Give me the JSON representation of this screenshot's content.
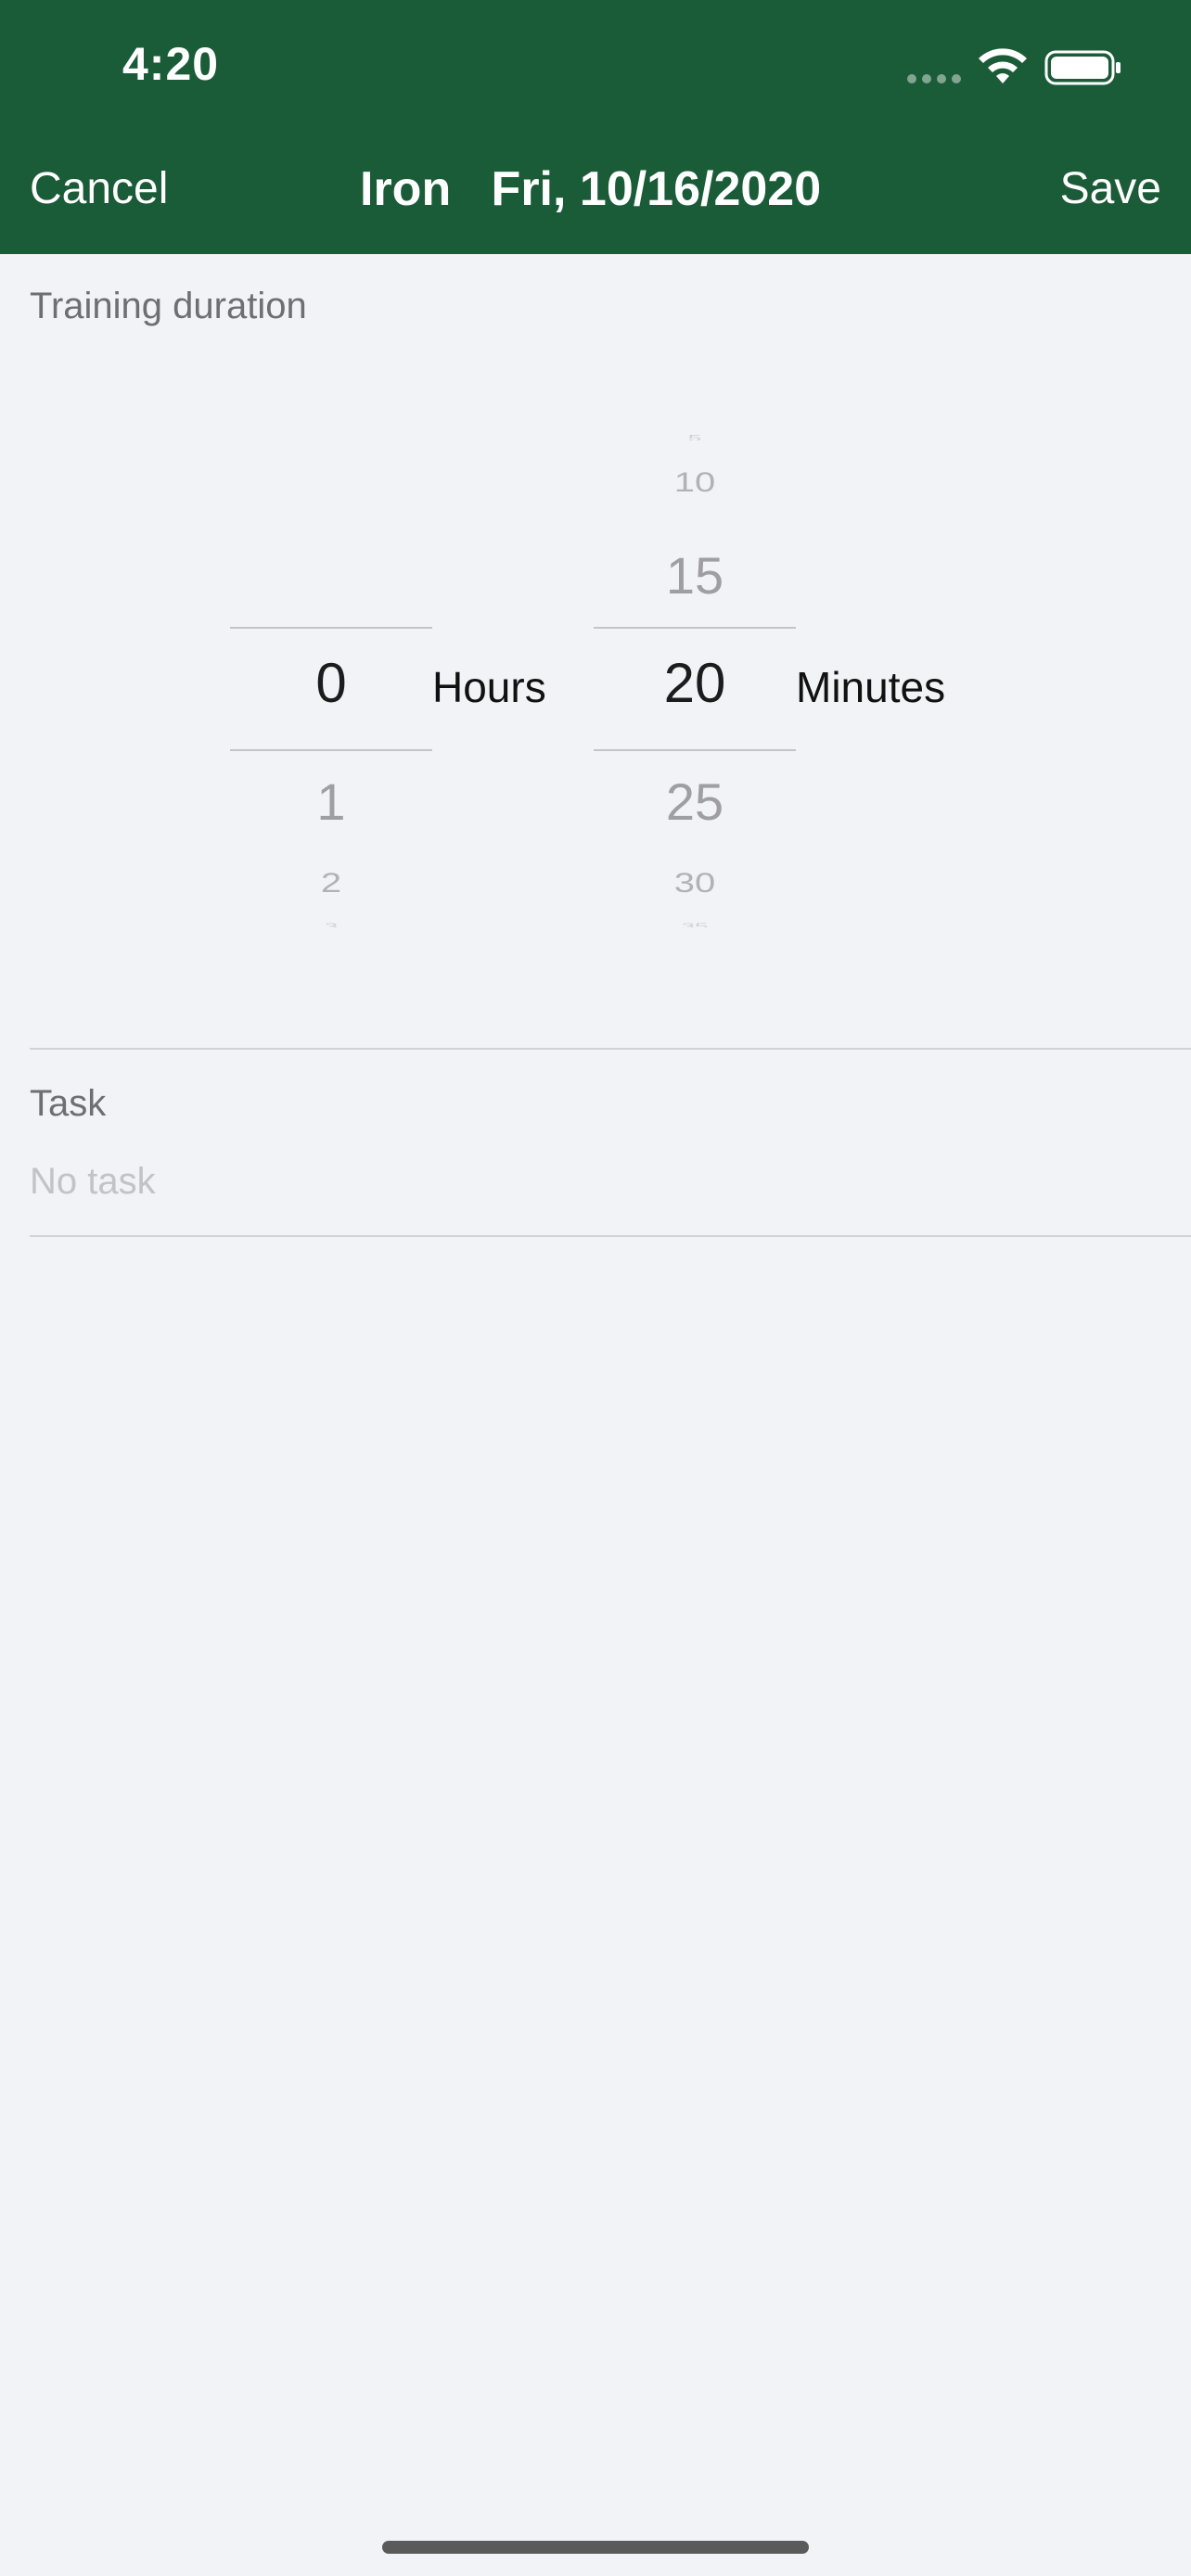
{
  "status_bar": {
    "time": "4:20"
  },
  "nav": {
    "cancel_label": "Cancel",
    "title": "Iron   Fri, 10/16/2020",
    "save_label": "Save"
  },
  "duration": {
    "section_label": "Training duration",
    "hours_unit": "Hours",
    "minutes_unit": "Minutes",
    "hours_selected": "0",
    "hours_next": [
      "1",
      "2",
      "3"
    ],
    "minutes_prev": [
      "5",
      "10",
      "15"
    ],
    "minutes_selected": "20",
    "minutes_next": [
      "25",
      "30",
      "35"
    ]
  },
  "task": {
    "section_label": "Task",
    "placeholder": "No task"
  },
  "colors": {
    "header_green": "#1b5c38",
    "background": "#f2f3f6"
  }
}
